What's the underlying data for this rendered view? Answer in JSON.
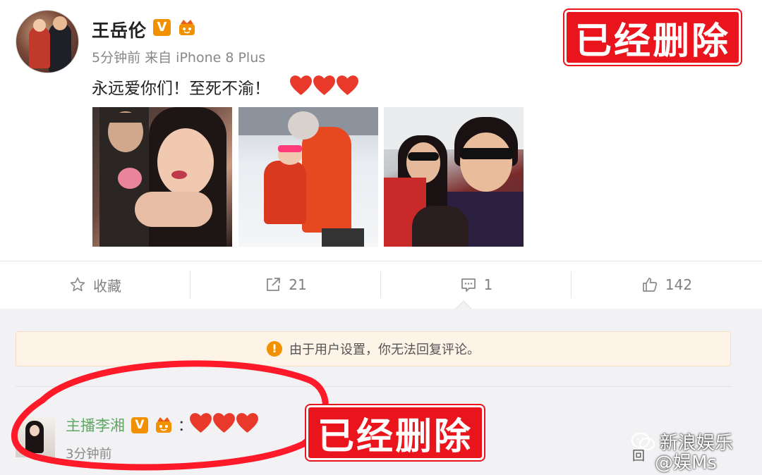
{
  "post": {
    "username": "王岳伦",
    "verified_badge": "V",
    "meta": "5分钟前 来自 iPhone 8 Plus",
    "text": "永远爱你们！至死不渝！",
    "hearts": [
      "heart",
      "heart",
      "heart"
    ],
    "photos": [
      "photo-1",
      "photo-2",
      "photo-3"
    ]
  },
  "actions": {
    "favorite_label": "收藏",
    "repost_count": "21",
    "comment_count": "1",
    "like_count": "142"
  },
  "comments": {
    "notice": "由于用户设置，你无法回复评论。",
    "items": [
      {
        "name": "主播李湘",
        "verified_badge": "V",
        "colon": "：",
        "time": "3分钟前",
        "reply_label": "回"
      }
    ]
  },
  "overlays": {
    "deleted_label_1": "已经删除",
    "deleted_label_2": "已经删除",
    "watermark_brand": "新浪娱乐",
    "watermark_weibo": "@娱Ms"
  },
  "colors": {
    "accent_orange": "#f29100",
    "delete_red": "#e9141c",
    "comment_name_green": "#5fa862",
    "heart_red": "#e8392b"
  }
}
